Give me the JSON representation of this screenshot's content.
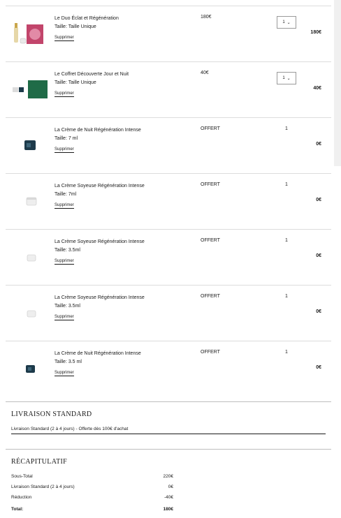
{
  "cart": {
    "items": [
      {
        "name": "Le Duo Éclat et Régénération",
        "size": "Taille: Taille Unique",
        "remove": "Supprimer",
        "price": "180€",
        "qty": "1",
        "total": "180€",
        "thumb": "duo-gift-box"
      },
      {
        "name": "Le Coffret Découverte Jour et Nuit",
        "size": "Taille: Taille Unique",
        "remove": "Supprimer",
        "price": "40€",
        "qty": "1",
        "total": "40€",
        "thumb": "green-coffret"
      },
      {
        "name": "La Crème de Nuit Régénération Intense",
        "size": "Taille: 7 ml",
        "remove": "Supprimer",
        "price": "OFFERT",
        "qty": "1",
        "total": "0€",
        "thumb": "dark-jar"
      },
      {
        "name": "La Crème Soyeuse Régénération Intense",
        "size": "Taille: 7ml",
        "remove": "Supprimer",
        "price": "OFFERT",
        "qty": "1",
        "total": "0€",
        "thumb": "white-jar"
      },
      {
        "name": "La Crème Soyeuse Régénération Intense",
        "size": "Taille: 3.5ml",
        "remove": "Supprimer",
        "price": "OFFERT",
        "qty": "1",
        "total": "0€",
        "thumb": "white-jar"
      },
      {
        "name": "La Crème Soyeuse Régénération Intense",
        "size": "Taille: 3.5ml",
        "remove": "Supprimer",
        "price": "OFFERT",
        "qty": "1",
        "total": "0€",
        "thumb": "white-jar"
      },
      {
        "name": "La Crème de Nuit Régénération Intense",
        "size": "Taille: 3.5 ml",
        "remove": "Supprimer",
        "price": "OFFERT",
        "qty": "1",
        "total": "0€",
        "thumb": "dark-jar"
      }
    ]
  },
  "shipping": {
    "title": "LIVRAISON STANDARD",
    "option": "Livraison Standard (2 à 4 jours) - Offerte dès 100€ d'achat"
  },
  "summary": {
    "title": "RÉCAPITULATIF",
    "subtotal_label": "Sous-Total",
    "subtotal_value": "220€",
    "shipping_label": "Livraison Standard (2 à 4 jours)",
    "shipping_value": "0€",
    "discount_label": "Réduction",
    "discount_value": "-40€",
    "total_label": "Total:",
    "total_value": "180€"
  },
  "colors": {
    "coffret_green": "#1f6b47",
    "dark_jar": "#1d3a4a",
    "pink_box": "#c2456b"
  }
}
